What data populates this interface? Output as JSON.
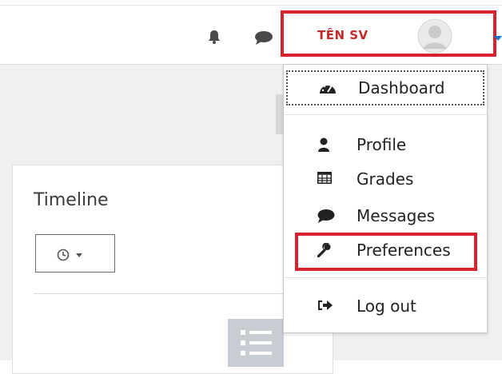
{
  "header": {
    "username": "TÊN SV"
  },
  "icons": {
    "notifications": "bell-icon",
    "messages": "chat-icon",
    "avatar": "user-avatar-icon",
    "caret": "caret-down-icon"
  },
  "timeline": {
    "title": "Timeline",
    "sort_icon": "clock-icon"
  },
  "user_menu": {
    "items": [
      {
        "label": "Dashboard",
        "icon": "dashboard-gauge-icon"
      },
      {
        "label": "Profile",
        "icon": "user-icon"
      },
      {
        "label": "Grades",
        "icon": "table-icon"
      },
      {
        "label": "Messages",
        "icon": "speech-bubble-icon"
      },
      {
        "label": "Preferences",
        "icon": "wrench-icon"
      },
      {
        "label": "Log out",
        "icon": "sign-out-icon"
      }
    ]
  },
  "colors": {
    "highlight": "#d8232f",
    "username": "#c62828",
    "icon": "#222222"
  }
}
